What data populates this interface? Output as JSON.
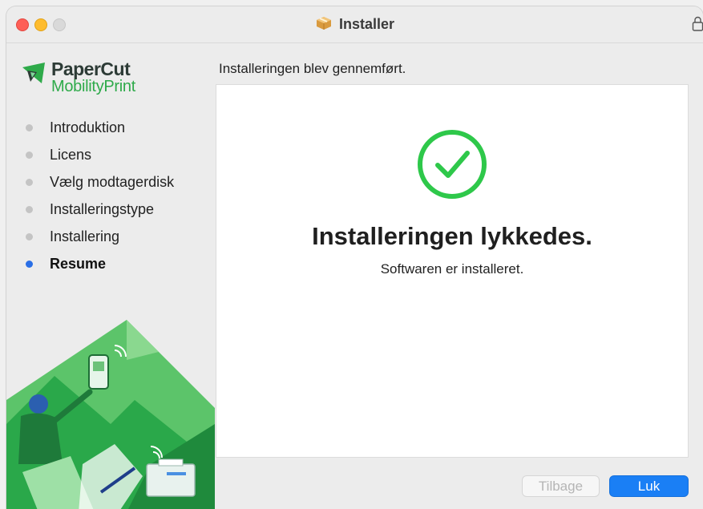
{
  "window": {
    "title": "Installer"
  },
  "sidebar": {
    "logo": {
      "line1": "PaperCut",
      "line2": "MobilityPrint"
    },
    "steps": [
      {
        "label": "Introduktion",
        "state": "done"
      },
      {
        "label": "Licens",
        "state": "done"
      },
      {
        "label": "Vælg modtagerdisk",
        "state": "done"
      },
      {
        "label": "Installeringstype",
        "state": "done"
      },
      {
        "label": "Installering",
        "state": "done"
      },
      {
        "label": "Resume",
        "state": "active"
      }
    ]
  },
  "main": {
    "heading": "Installeringen blev gennemført.",
    "success_title": "Installeringen lykkedes.",
    "success_subtitle": "Softwaren er installeret."
  },
  "buttons": {
    "back": "Tilbage",
    "close": "Luk"
  },
  "colors": {
    "accent": "#1a7ff5",
    "success": "#2ec84a",
    "brand_green": "#2eaa4a"
  }
}
